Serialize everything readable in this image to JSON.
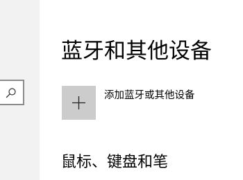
{
  "page": {
    "title": "蓝牙和其他设备"
  },
  "actions": {
    "add_device_label": "添加蓝牙或其他设备"
  },
  "sections": {
    "mouse_heading": "鼠标、键盘和笔"
  },
  "icons": {
    "search": "search-icon",
    "add": "plus-icon"
  },
  "colors": {
    "left_pane_bg": "#f2f2f2",
    "add_tile_bg": "#cccccc",
    "search_border": "#8a8a8a",
    "text": "#000000"
  }
}
